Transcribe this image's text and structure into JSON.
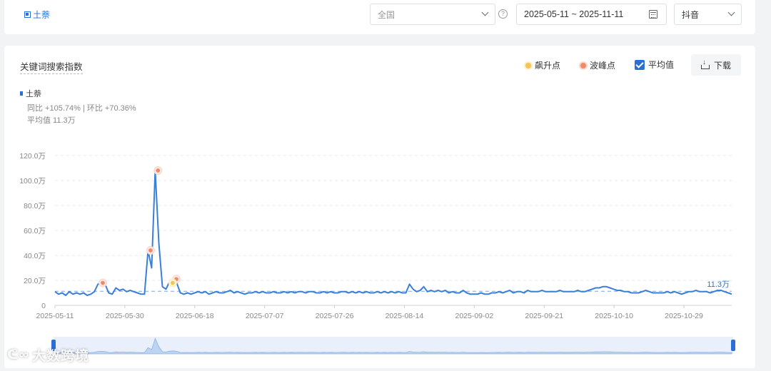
{
  "filter_bar": {
    "keyword_tag": "土萘",
    "region_placeholder": "全国",
    "help_icon": "help-circle-icon",
    "date_range": "2025-05-11 ~ 2025-11-11",
    "platform": "抖音"
  },
  "panel": {
    "title": "关键词搜索指数",
    "legend_rise": "飙升点",
    "legend_peak": "波峰点",
    "avg_toggle_label": "平均值",
    "avg_toggle_checked": true,
    "download_label": "下载",
    "series_key": "土萘",
    "stats_yoy": "同比 +105.74% | 环比 +70.36%",
    "stats_avg": "平均值 11.3万"
  },
  "watermark": "大数跨境",
  "colors": {
    "accent": "#2a6fd6",
    "line": "#3a7fd8",
    "rise_point": "#f5c553",
    "peak_point": "#f08a6a",
    "avg_line": "#7aa7e0"
  },
  "chart_data": {
    "type": "line",
    "title": "",
    "xlabel": "",
    "ylabel": "",
    "ylim": [
      0,
      120
    ],
    "y_unit": "万",
    "y_ticks": [
      "0",
      "20.0万",
      "40.0万",
      "60.0万",
      "80.0万",
      "100.0万",
      "120.0万"
    ],
    "y_tick_values": [
      0,
      20,
      40,
      60,
      80,
      100,
      120
    ],
    "x_ticks": [
      "2025-05-11",
      "2025-05-30",
      "2025-06-18",
      "2025-07-07",
      "2025-07-26",
      "2025-08-14",
      "2025-09-02",
      "2025-09-21",
      "2025-10-10",
      "2025-10-29"
    ],
    "x_range": [
      "2025-05-11",
      "2025-11-11"
    ],
    "average": 11.3,
    "average_label": "11.3万",
    "grid": "horizontal-dashed",
    "series": [
      {
        "name": "土萘",
        "values": [
          11,
          9,
          10,
          8,
          11,
          9,
          10,
          9,
          10,
          8,
          9,
          11,
          17,
          18,
          17,
          10,
          9,
          14,
          12,
          13,
          11,
          12,
          11,
          10,
          9,
          9,
          44,
          30,
          108,
          50,
          15,
          13,
          19,
          21,
          18,
          10,
          9,
          10,
          9,
          10,
          11,
          10,
          11,
          9,
          10,
          11,
          10,
          10,
          11,
          12,
          10,
          11,
          10,
          9,
          10,
          10,
          11,
          10,
          11,
          10,
          10,
          11,
          10,
          10,
          11,
          10,
          11,
          10,
          11,
          11,
          10,
          11,
          11,
          10,
          10,
          11,
          10,
          11,
          10,
          10,
          11,
          11,
          10,
          11,
          10,
          11,
          10,
          11,
          10,
          10,
          11,
          10,
          11,
          10,
          11,
          10,
          11,
          10,
          10,
          17,
          13,
          11,
          12,
          15,
          11,
          12,
          11,
          12,
          11,
          12,
          10,
          11,
          10,
          10,
          12,
          10,
          9,
          9,
          9,
          10,
          9,
          9,
          10,
          10,
          11,
          10,
          11,
          12,
          10,
          11,
          11,
          10,
          12,
          11,
          11,
          11,
          12,
          11,
          11,
          11,
          11,
          12,
          11,
          11,
          11,
          11,
          12,
          11,
          11,
          12,
          13,
          14,
          14,
          15,
          15,
          14,
          13,
          12,
          12,
          11,
          11,
          10,
          10,
          10,
          11,
          12,
          11,
          10,
          10,
          10,
          10,
          11,
          10,
          11,
          10,
          9,
          10,
          11,
          11,
          12,
          11,
          11,
          11,
          10,
          11,
          12,
          12,
          11,
          10,
          9
        ]
      }
    ],
    "peak_points": [
      {
        "x": "2025-05-24",
        "y": 18
      },
      {
        "x": "2025-06-06",
        "y": 44
      },
      {
        "x": "2025-06-08",
        "y": 108
      },
      {
        "x": "2025-06-13",
        "y": 21
      }
    ],
    "rise_points": [
      {
        "x": "2025-06-12",
        "y": 18
      }
    ]
  }
}
